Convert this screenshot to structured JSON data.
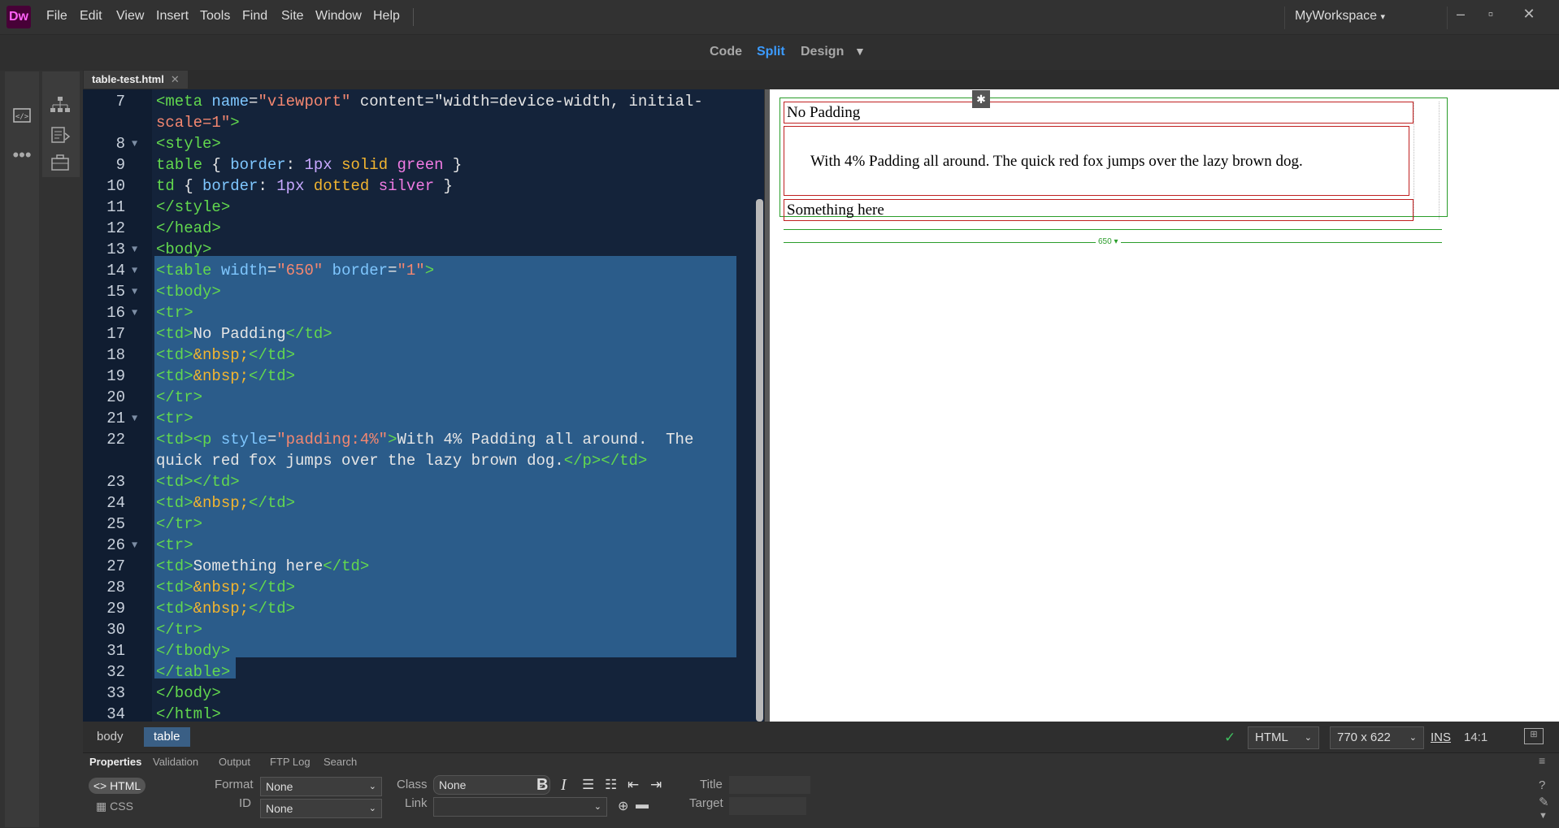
{
  "app": {
    "logo": "Dw",
    "workspace": "MyWorkspace"
  },
  "menu": [
    "File",
    "Edit",
    "View",
    "Insert",
    "Tools",
    "Find",
    "Site",
    "Window",
    "Help"
  ],
  "view_modes": {
    "code": "Code",
    "split": "Split",
    "design": "Design",
    "active": "Split"
  },
  "document_tab": "table-test.html",
  "line_numbers": [
    "7",
    "8",
    "9",
    "10",
    "11",
    "12",
    "13",
    "14",
    "15",
    "16",
    "17",
    "18",
    "19",
    "20",
    "21",
    "22",
    "23",
    "24",
    "25",
    "26",
    "27",
    "28",
    "29",
    "30",
    "31",
    "32",
    "33",
    "34"
  ],
  "code_lines": [
    "<meta name=\"viewport\" content=\"width=device-width, initial-",
    "scale=1\">",
    "<style>",
    "table { border: 1px solid green }",
    "td { border: 1px dotted silver }",
    "</style>",
    "</head>",
    "<body>",
    "<table width=\"650\" border=\"1\">",
    "<tbody>",
    "<tr>",
    "<td>No Padding</td>",
    "<td>&nbsp;</td>",
    "<td>&nbsp;</td>",
    "</tr>",
    "<tr>",
    "<td><p style=\"padding:4%\">With 4% Padding all around.  The",
    "quick red fox jumps over the lazy brown dog.</p></td>",
    "<td></td>",
    "<td>&nbsp;</td>",
    "</tr>",
    "<tr>",
    "<td>Something here</td>",
    "<td>&nbsp;</td>",
    "<td>&nbsp;</td>",
    "</tr>",
    "</tbody>",
    "</table>",
    "</body>",
    "</html>"
  ],
  "design_view": {
    "cell1": "No Padding",
    "cell2": "With 4% Padding all around. The quick red fox jumps over the lazy brown dog.",
    "cell3": "Something here",
    "table_width_label": "650"
  },
  "status_bar": {
    "breadcrumbs": [
      "body",
      "table"
    ],
    "doc_type": "HTML",
    "window_size": "770 x 622",
    "insert_mode": "INS",
    "cursor_position": "14:1"
  },
  "properties_panel": {
    "tabs": [
      "Properties",
      "Validation",
      "Output",
      "FTP Log",
      "Search"
    ],
    "html_button": "HTML",
    "css_button": "CSS",
    "format_label": "Format",
    "format_value": "None",
    "id_label": "ID",
    "id_value": "None",
    "class_label": "Class",
    "class_value": "None",
    "link_label": "Link",
    "title_label": "Title",
    "target_label": "Target"
  },
  "colors": {
    "accent": "#2d9cff",
    "selection": "#2b5c8a",
    "table_border": "#2a9d2a",
    "cell_border": "#c02020"
  }
}
